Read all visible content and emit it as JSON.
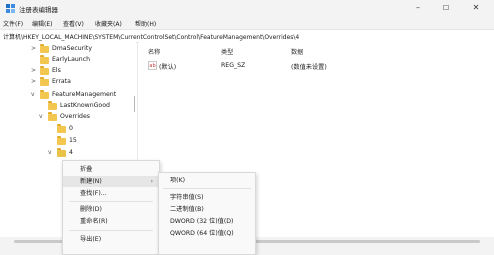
{
  "window": {
    "title": "注册表编辑器",
    "controls": {
      "minimize": "–",
      "maximize": "☐",
      "close": "✕"
    }
  },
  "menubar": [
    "文件(F)",
    "编辑(E)",
    "查看(V)",
    "收藏夹(A)",
    "帮助(H)"
  ],
  "address": "计算机\\HKEY_LOCAL_MACHINE\\SYSTEM\\CurrentControlSet\\Control\\FeatureManagement\\Overrides\\4",
  "tree": [
    {
      "label": "DmaSecurity",
      "chevron": ">"
    },
    {
      "label": "EarlyLaunch",
      "chevron": ""
    },
    {
      "label": "Els",
      "chevron": ">"
    },
    {
      "label": "Errata",
      "chevron": ">"
    },
    {
      "label": "FeatureManagement",
      "chevron": "v"
    },
    {
      "label": "LastKnownGood",
      "chevron": ""
    },
    {
      "label": "Overrides",
      "chevron": "v"
    },
    {
      "label": "0",
      "chevron": ""
    },
    {
      "label": "15",
      "chevron": ""
    },
    {
      "label": "4",
      "chevron": "v"
    }
  ],
  "list": {
    "headers": {
      "name": "名称",
      "type": "类型",
      "data": "数据"
    },
    "rows": [
      {
        "icon": "ab",
        "name": "(默认)",
        "type": "REG_SZ",
        "data": "(数值未设置)"
      }
    ]
  },
  "context_menu": {
    "items": [
      "折叠",
      "新建(N)",
      "查找(F)...",
      "删除(D)",
      "重命名(R)",
      "导出(E)"
    ],
    "submenu_arrow": "›"
  },
  "submenu": {
    "items": [
      "项(K)",
      "字符串值(S)",
      "二进制值(B)",
      "DWORD (32 位)值(D)",
      "QWORD (64 位)值(Q)"
    ]
  },
  "colors": {
    "folder": "#f3c64f",
    "highlight": "#e6e6e6",
    "selected_folder": "#e9c24a"
  }
}
